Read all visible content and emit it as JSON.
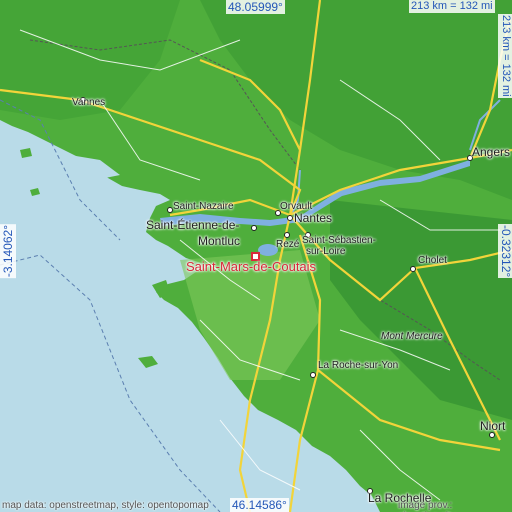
{
  "map": {
    "colors": {
      "sea": "#b9dbe8",
      "land_high": "#2e8b2e",
      "land_mid": "#4fae3c",
      "land_low": "#7ec85a",
      "road": "#f2d43a",
      "road_minor": "#ffffff",
      "river": "#7fb0e0",
      "border": "#555555",
      "coord_text": "#2457b8",
      "target": "#d9283a"
    },
    "coords": {
      "top": "48.05999°",
      "bottom": "46.14586°",
      "left": "-3.14062°",
      "right": "-0.32312°"
    },
    "scale": {
      "horizontal": "213 km = 132 mi",
      "vertical": "213 km = 132 mi"
    },
    "cities": [
      {
        "key": "vannes",
        "label": "Vannes"
      },
      {
        "key": "angers",
        "label": "Angers"
      },
      {
        "key": "saint_nazaire",
        "label": "Saint-Nazaire"
      },
      {
        "key": "orvault",
        "label": "Orvault"
      },
      {
        "key": "nantes",
        "label": "Nantes"
      },
      {
        "key": "saint_etienne",
        "label": "Saint-Étienne-de-"
      },
      {
        "key": "saint_etienne2",
        "label": "Montluc"
      },
      {
        "key": "reze",
        "label": "Rezé"
      },
      {
        "key": "saint_sebastien",
        "label": "Saint-Sébastien-"
      },
      {
        "key": "saint_sebastien2",
        "label": "sur-Loire"
      },
      {
        "key": "cholet",
        "label": "Cholet"
      },
      {
        "key": "mont_mercure",
        "label": "Mont Mercure"
      },
      {
        "key": "la_roche",
        "label": "La Roche-sur-Yon"
      },
      {
        "key": "niort",
        "label": "Niort"
      },
      {
        "key": "la_rochelle",
        "label": "La Rochelle"
      }
    ],
    "target": "Saint-Mars-de-Coutais",
    "credits": {
      "left": "map data: openstreetmap, style: opentopomap",
      "right": "image prov.: elevation.city"
    }
  }
}
